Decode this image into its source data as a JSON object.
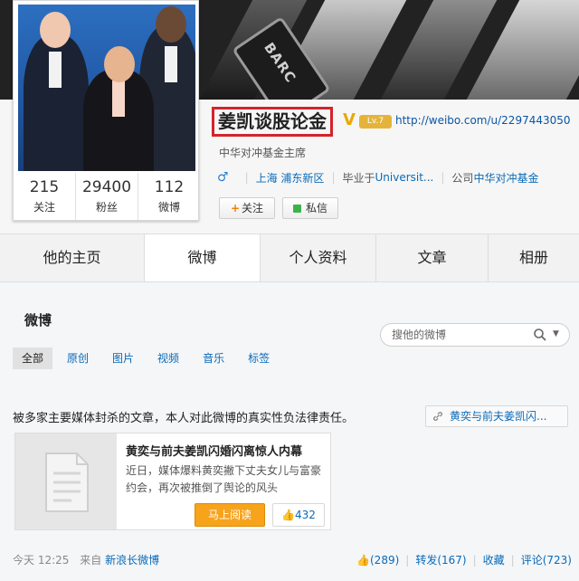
{
  "profile": {
    "name": "姜凯谈股论金",
    "verified_mark": "V",
    "level_badge": "Lv.7",
    "url": "http://weibo.com/u/2297443050",
    "bio": "中华对冲基金主席",
    "gender_icon": "male-icon",
    "location": "上海 浦东新区",
    "school_prefix": "毕业于",
    "school": "Universit...",
    "company_prefix": "公司",
    "company": "中华对冲基金",
    "follow_label": "关注",
    "message_label": "私信",
    "stats": [
      {
        "value": "215",
        "label": "关注"
      },
      {
        "value": "29400",
        "label": "粉丝"
      },
      {
        "value": "112",
        "label": "微博"
      }
    ]
  },
  "banner": {
    "badge_text": "BARC"
  },
  "tabs": [
    {
      "label": "他的主页",
      "active": false
    },
    {
      "label": "微博",
      "active": true
    },
    {
      "label": "个人资料",
      "active": false
    },
    {
      "label": "文章",
      "active": false
    },
    {
      "label": "相册",
      "active": false
    }
  ],
  "weibo": {
    "section_title": "微博",
    "search_placeholder": "搜他的微博",
    "filters": [
      "全部",
      "原创",
      "图片",
      "视频",
      "音乐",
      "标签"
    ],
    "post": {
      "text": "被多家主要媒体封杀的文章，本人对此微博的真实性负法律责任。",
      "tag": "黄奕与前夫姜凯闪...",
      "article": {
        "title": "黄奕与前夫姜凯闪婚闪离惊人内幕",
        "summary": "近日，媒体爆料黄奕撇下丈夫女儿与富豪约会，再次被推倒了舆论的风头",
        "read_label": "马上阅读",
        "like_count": "432"
      },
      "time": "今天 12:25",
      "source_prefix": "来自",
      "source": "新浪长微博",
      "likes": "(289)",
      "repost": "转发(167)",
      "favorite": "收藏",
      "comment": "评论(723)"
    }
  },
  "colors": {
    "accent_link": "#0a6ab7",
    "highlight_border": "#d4232b",
    "read_button": "#f7a31c"
  }
}
